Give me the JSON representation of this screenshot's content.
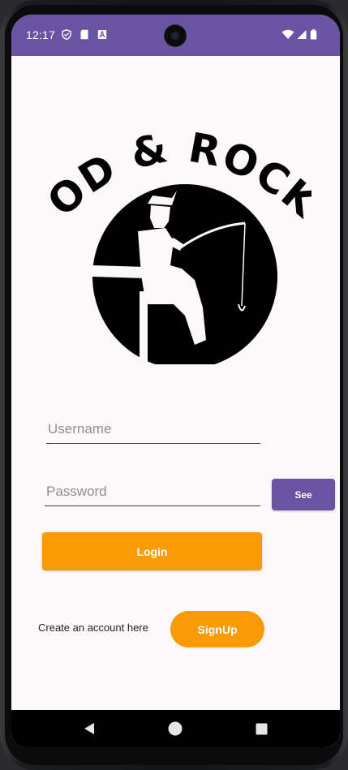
{
  "status_bar": {
    "time": "12:17",
    "icons_left": [
      "shield-icon",
      "sd-card-icon",
      "a-badge-icon"
    ],
    "icons_right": [
      "wifi-icon",
      "signal-icon",
      "battery-icon"
    ],
    "color": "#6a53a3"
  },
  "logo": {
    "text": "ROD & ROCKS",
    "icon": "fisherman-logo"
  },
  "form": {
    "username_placeholder": "Username",
    "username_value": "",
    "password_placeholder": "Password",
    "password_value": "",
    "see_label": "See",
    "login_label": "Login"
  },
  "signup": {
    "prompt": "Create an account here",
    "button_label": "SignUp"
  },
  "colors": {
    "accent_purple": "#6a53a3",
    "accent_orange": "#fa9a05",
    "background": "#fcf8fa"
  },
  "nav_bar": {
    "icons": [
      "back-icon",
      "home-icon",
      "recents-icon"
    ]
  }
}
